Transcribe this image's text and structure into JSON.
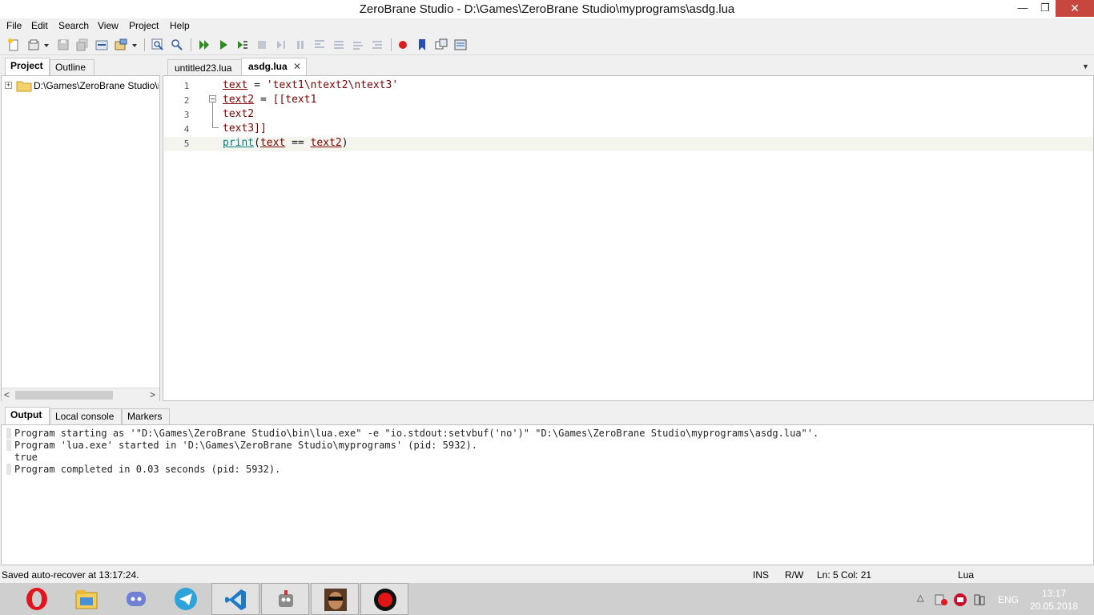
{
  "window": {
    "title": "ZeroBrane Studio - D:\\Games\\ZeroBrane Studio\\myprograms\\asdg.lua",
    "min_glyph": "—",
    "max_glyph": "❐",
    "close_glyph": "✕"
  },
  "menu": [
    "File",
    "Edit",
    "Search",
    "View",
    "Project",
    "Help"
  ],
  "toolbar": {
    "icons": [
      "new-file-icon",
      "open-file-icon",
      "save-icon",
      "save-all-icon",
      "project-directory-icon",
      "find-icon",
      "find-in-files-icon",
      "run-icon",
      "start-debug-icon",
      "run-to-cursor-icon",
      "stop-icon",
      "break-icon",
      "step-into-icon",
      "step-over-icon",
      "step-out-icon",
      "toggle-breakpoint-icon",
      "bookmark-icon",
      "watch-icon",
      "stack-window-icon"
    ],
    "accent_run": "#2e8b1f",
    "accent_breakpoint": "#d81f1f"
  },
  "left_panel": {
    "tabs": [
      "Project",
      "Outline"
    ],
    "tree_root": "D:\\Games\\ZeroBrane Studio\\myprograms",
    "expander": "+",
    "scroll_left": "<",
    "scroll_right": ">"
  },
  "editor": {
    "tabs": [
      "untitled23.lua",
      "asdg.lua"
    ],
    "active_tab": "asdg.lua",
    "close_glyph": "✕",
    "dropdown_glyph": "▼",
    "lines": [
      {
        "num": "1",
        "parts": [
          [
            "id",
            "text"
          ],
          [
            "op",
            " = "
          ],
          [
            "str",
            "'text1\\ntext2\\ntext3'"
          ]
        ]
      },
      {
        "num": "2",
        "parts": [
          [
            "id",
            "text2"
          ],
          [
            "op",
            " = "
          ],
          [
            "str",
            "[[text1"
          ]
        ]
      },
      {
        "num": "3",
        "parts": [
          [
            "str",
            "text2"
          ]
        ]
      },
      {
        "num": "4",
        "parts": [
          [
            "str",
            "text3]]"
          ]
        ]
      },
      {
        "num": "5",
        "parts": [
          [
            "kw",
            "print"
          ],
          [
            "op",
            "("
          ],
          [
            "id",
            "text"
          ],
          [
            "op",
            " == "
          ],
          [
            "id",
            "text2"
          ],
          [
            "op",
            ")"
          ]
        ]
      }
    ]
  },
  "output_panel": {
    "tabs": [
      "Output",
      "Local console",
      "Markers"
    ],
    "lines": [
      "Program starting as '\"D:\\Games\\ZeroBrane Studio\\bin\\lua.exe\" -e \"io.stdout:setvbuf('no')\" \"D:\\Games\\ZeroBrane Studio\\myprograms\\asdg.lua\"'.",
      "Program 'lua.exe' started in 'D:\\Games\\ZeroBrane Studio\\myprograms' (pid: 5932).",
      "true",
      "Program completed in 0.03 seconds (pid: 5932)."
    ]
  },
  "status": {
    "message": "Saved auto-recover at 13:17:24.",
    "ins": "INS",
    "rw": "R/W",
    "position": "Ln: 5 Col: 21",
    "language": "Lua"
  },
  "taskbar": {
    "apps": [
      "opera-icon",
      "file-explorer-icon",
      "discord-icon",
      "telegram-icon",
      "vscode-icon",
      "zerobrane-icon",
      "game-icon",
      "record-icon"
    ],
    "lang": "ENG",
    "time": "13:17",
    "date": "20.05.2018",
    "tray_arrow": "△"
  }
}
